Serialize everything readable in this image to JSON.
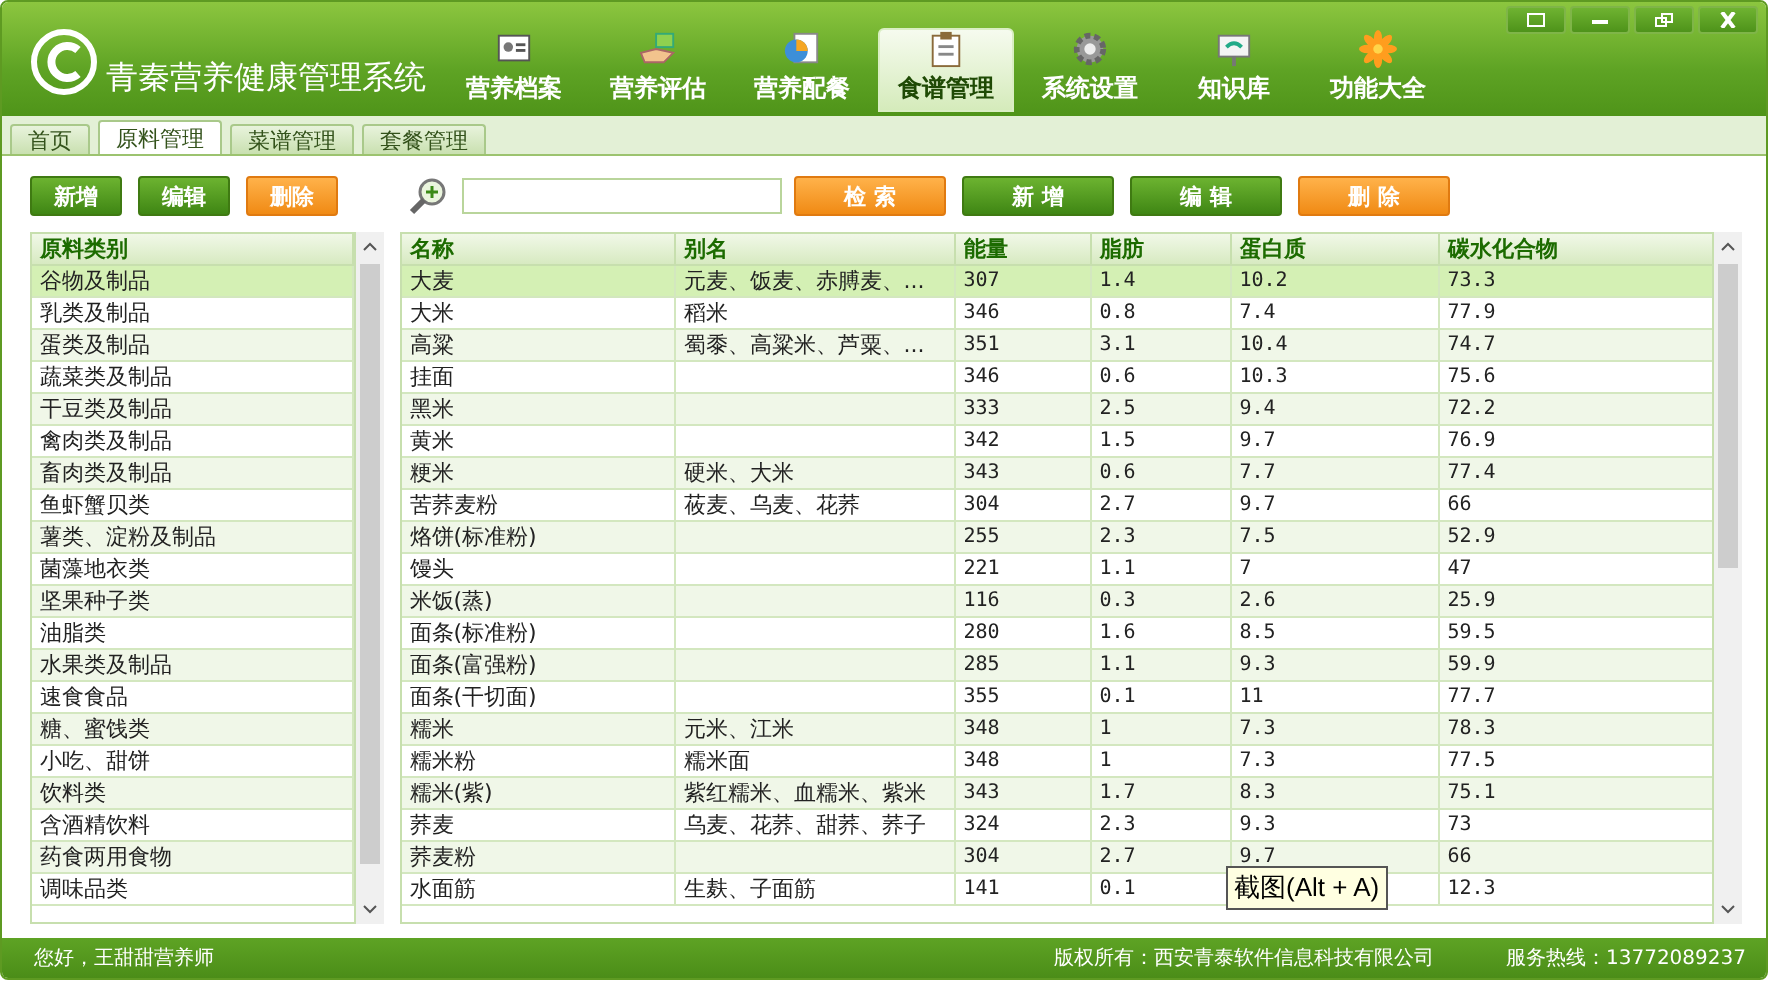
{
  "app": {
    "title": "青秦营养健康管理系统"
  },
  "nav": [
    {
      "label": "营养档案",
      "selected": false
    },
    {
      "label": "营养评估",
      "selected": false
    },
    {
      "label": "营养配餐",
      "selected": false
    },
    {
      "label": "食谱管理",
      "selected": true
    },
    {
      "label": "系统设置",
      "selected": false
    },
    {
      "label": "知识库",
      "selected": false
    },
    {
      "label": "功能大全",
      "selected": false
    }
  ],
  "tabs": [
    {
      "label": "首页",
      "selected": false
    },
    {
      "label": "原料管理",
      "selected": true
    },
    {
      "label": "菜谱管理",
      "selected": false
    },
    {
      "label": "套餐管理",
      "selected": false
    }
  ],
  "left_buttons": [
    {
      "label": "新增",
      "kind": "action"
    },
    {
      "label": "编辑",
      "kind": "action"
    },
    {
      "label": "删除",
      "kind": "delete"
    }
  ],
  "right_buttons": [
    {
      "label": "检 索",
      "kind": "delete"
    },
    {
      "label": "新 增",
      "kind": "action"
    },
    {
      "label": "编 辑",
      "kind": "action"
    },
    {
      "label": "删 除",
      "kind": "delete"
    }
  ],
  "categories": {
    "column": "原料类别",
    "rows": [
      {
        "name": "谷物及制品",
        "selected": true
      },
      {
        "name": "乳类及制品",
        "selected": false
      },
      {
        "name": "蛋类及制品",
        "selected": false
      },
      {
        "name": "蔬菜类及制品",
        "selected": false
      },
      {
        "name": "干豆类及制品",
        "selected": false
      },
      {
        "name": "禽肉类及制品",
        "selected": false
      },
      {
        "name": "畜肉类及制品",
        "selected": false
      },
      {
        "name": "鱼虾蟹贝类",
        "selected": false
      },
      {
        "name": "薯类、淀粉及制品",
        "selected": false
      },
      {
        "name": "菌藻地衣类",
        "selected": false
      },
      {
        "name": "坚果种子类",
        "selected": false
      },
      {
        "name": "油脂类",
        "selected": false
      },
      {
        "name": "水果类及制品",
        "selected": false
      },
      {
        "name": "速食食品",
        "selected": false
      },
      {
        "name": "糖、蜜饯类",
        "selected": false
      },
      {
        "name": "小吃、甜饼",
        "selected": false
      },
      {
        "name": "饮料类",
        "selected": false
      },
      {
        "name": "含酒精饮料",
        "selected": false
      },
      {
        "name": "药食两用食物",
        "selected": false
      },
      {
        "name": "调味品类",
        "selected": false
      }
    ]
  },
  "ingredients": {
    "columns": [
      "名称",
      "别名",
      "能量",
      "脂肪",
      "蛋白质",
      "碳水化合物"
    ],
    "rows": [
      {
        "cells": [
          "大麦",
          "元麦、饭麦、赤膊麦、...",
          "307",
          "1.4",
          "10.2",
          "73.3"
        ],
        "selected": true
      },
      {
        "cells": [
          "大米",
          "稻米",
          "346",
          "0.8",
          "7.4",
          "77.9"
        ],
        "selected": false
      },
      {
        "cells": [
          "高粱",
          "蜀黍、高粱米、芦粟、...",
          "351",
          "3.1",
          "10.4",
          "74.7"
        ],
        "selected": false
      },
      {
        "cells": [
          "挂面",
          null,
          "346",
          "0.6",
          "10.3",
          "75.6"
        ],
        "selected": false
      },
      {
        "cells": [
          "黑米",
          null,
          "333",
          "2.5",
          "9.4",
          "72.2"
        ],
        "selected": false
      },
      {
        "cells": [
          "黄米",
          null,
          "342",
          "1.5",
          "9.7",
          "76.9"
        ],
        "selected": false
      },
      {
        "cells": [
          "粳米",
          "硬米、大米",
          "343",
          "0.6",
          "7.7",
          "77.4"
        ],
        "selected": false
      },
      {
        "cells": [
          "苦荞麦粉",
          "莜麦、乌麦、花荞",
          "304",
          "2.7",
          "9.7",
          "66"
        ],
        "selected": false
      },
      {
        "cells": [
          "烙饼(标准粉)",
          null,
          "255",
          "2.3",
          "7.5",
          "52.9"
        ],
        "selected": false
      },
      {
        "cells": [
          "馒头",
          null,
          "221",
          "1.1",
          "7",
          "47"
        ],
        "selected": false
      },
      {
        "cells": [
          "米饭(蒸)",
          null,
          "116",
          "0.3",
          "2.6",
          "25.9"
        ],
        "selected": false
      },
      {
        "cells": [
          "面条(标准粉)",
          null,
          "280",
          "1.6",
          "8.5",
          "59.5"
        ],
        "selected": false
      },
      {
        "cells": [
          "面条(富强粉)",
          null,
          "285",
          "1.1",
          "9.3",
          "59.9"
        ],
        "selected": false
      },
      {
        "cells": [
          "面条(干切面)",
          null,
          "355",
          "0.1",
          "11",
          "77.7"
        ],
        "selected": false
      },
      {
        "cells": [
          "糯米",
          "元米、江米",
          "348",
          "1",
          "7.3",
          "78.3"
        ],
        "selected": false
      },
      {
        "cells": [
          "糯米粉",
          "糯米面",
          "348",
          "1",
          "7.3",
          "77.5"
        ],
        "selected": false
      },
      {
        "cells": [
          "糯米(紫)",
          "紫红糯米、血糯米、紫米",
          "343",
          "1.7",
          "8.3",
          "75.1"
        ],
        "selected": false
      },
      {
        "cells": [
          "荞麦",
          "乌麦、花荞、甜荞、荞子",
          "324",
          "2.3",
          "9.3",
          "73"
        ],
        "selected": false
      },
      {
        "cells": [
          "荞麦粉",
          null,
          "304",
          "2.7",
          "9.7",
          "66"
        ],
        "selected": false
      },
      {
        "cells": [
          "水面筋",
          "生麸、子面筋",
          "141",
          "0.1",
          null,
          "12.3"
        ],
        "selected": false
      }
    ]
  },
  "tooltip": "截图(Alt + A)",
  "status_bar": {
    "greeting": "您好，王甜甜营养师",
    "copyright": "版权所有：西安青泰软件信息科技有限公司",
    "hotline": "服务热线：13772089237"
  }
}
